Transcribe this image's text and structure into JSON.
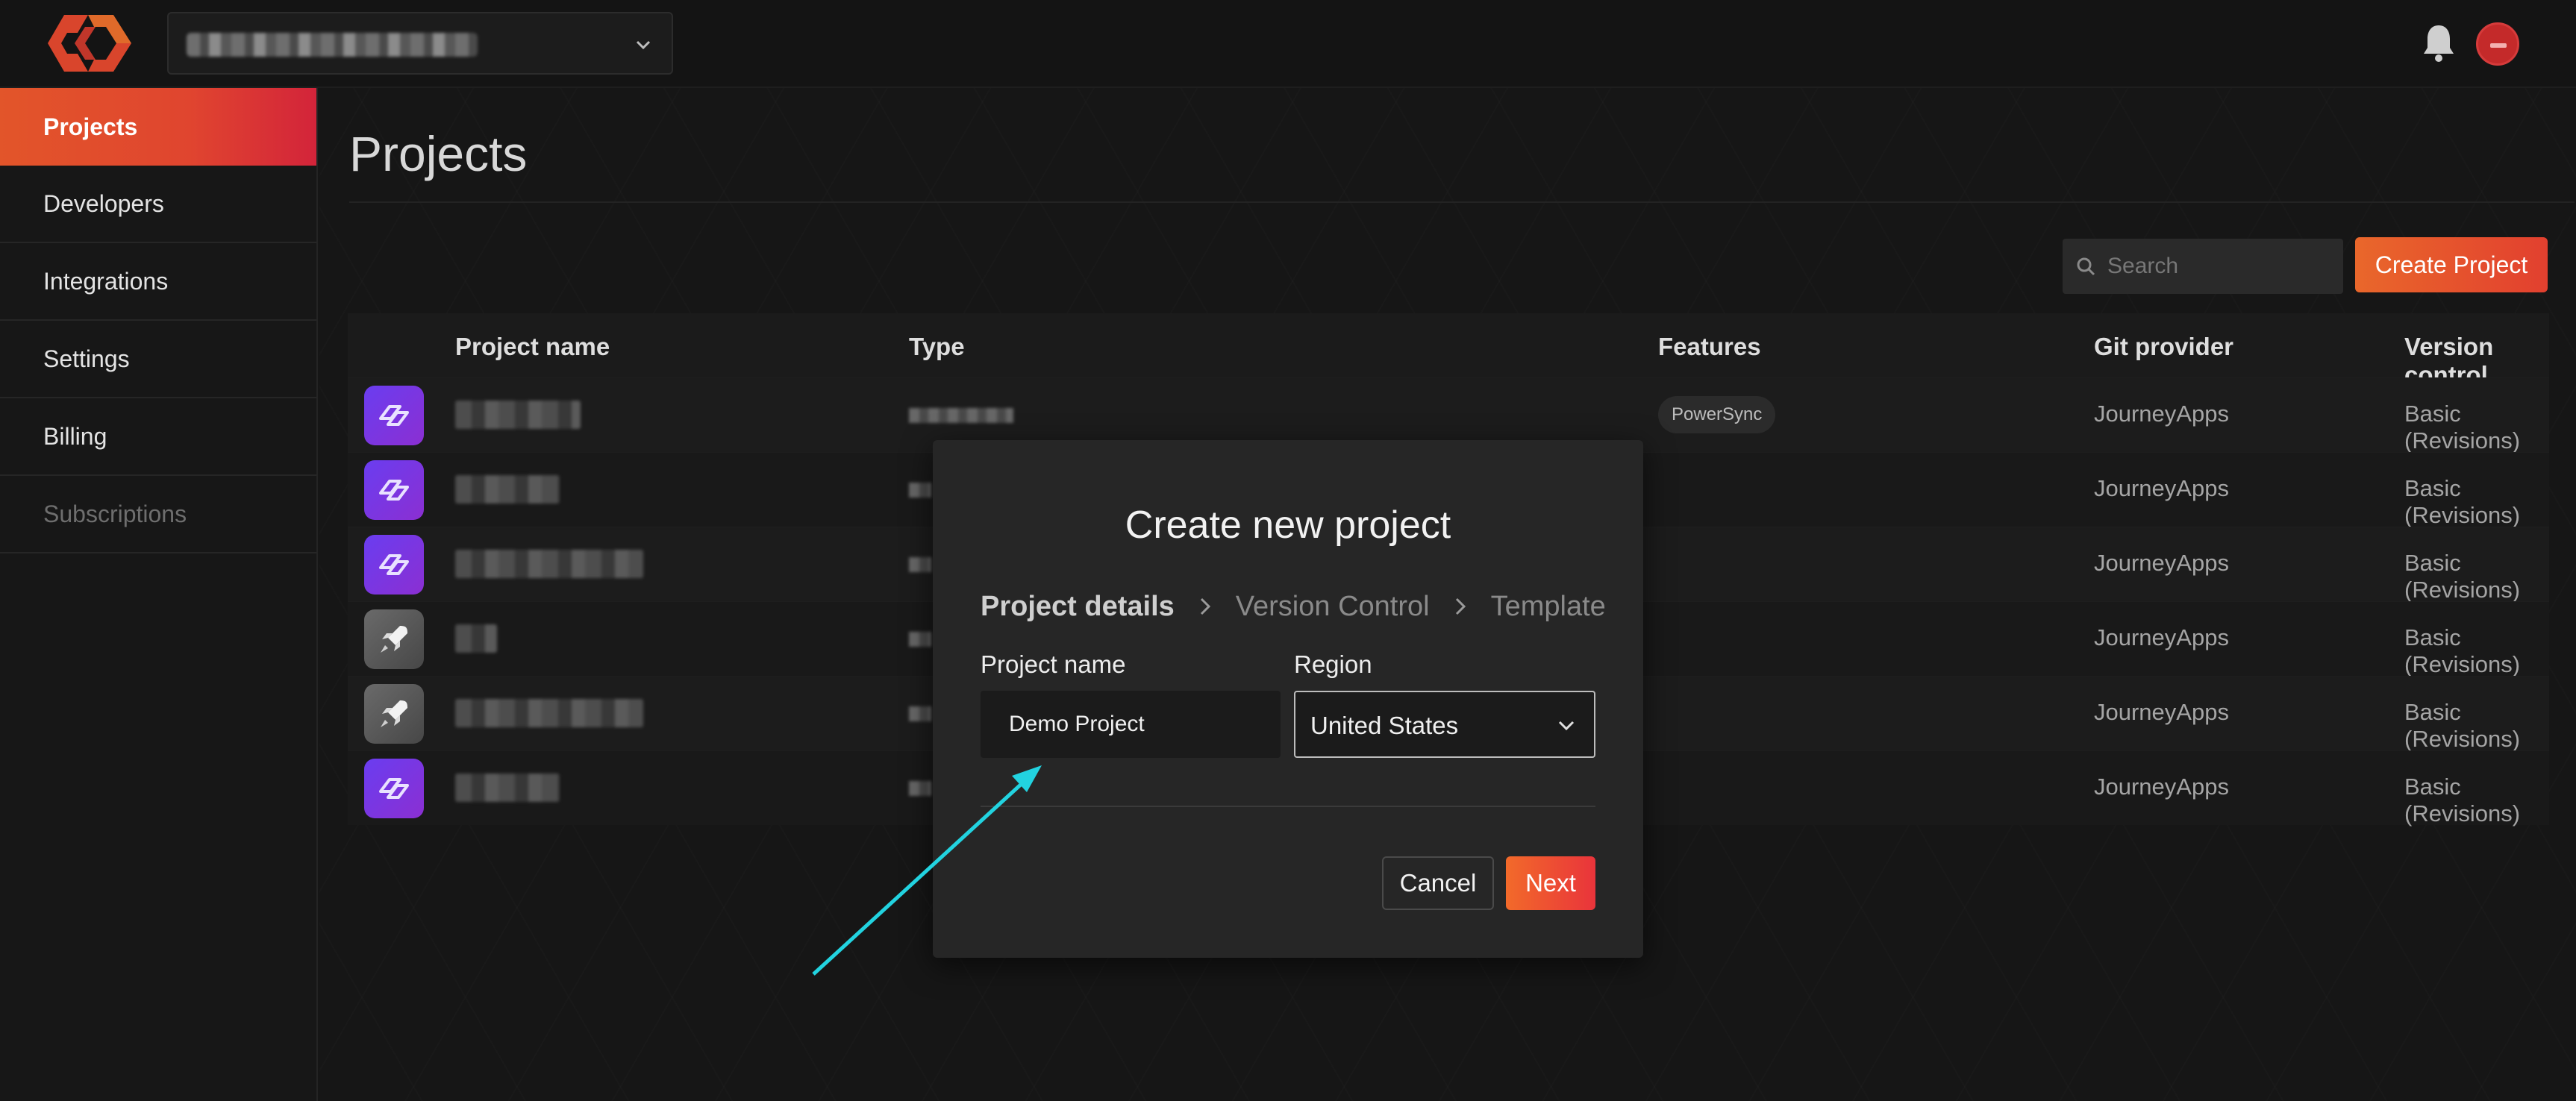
{
  "nav": {
    "items": [
      {
        "label": "Projects"
      },
      {
        "label": "Developers"
      },
      {
        "label": "Integrations"
      },
      {
        "label": "Settings"
      },
      {
        "label": "Billing"
      },
      {
        "label": "Subscriptions"
      }
    ]
  },
  "page": {
    "title": "Projects",
    "search_placeholder": "Search",
    "create_button": "Create Project"
  },
  "table": {
    "headers": {
      "project_name": "Project name",
      "type": "Type",
      "features": "Features",
      "git_provider": "Git provider",
      "version_control": "Version control"
    },
    "rows": [
      {
        "icon": "powersync-icon",
        "feature": "PowerSync",
        "git": "JourneyApps",
        "vc": "Basic (Revisions)"
      },
      {
        "icon": "powersync-icon",
        "feature": "",
        "git": "JourneyApps",
        "vc": "Basic (Revisions)"
      },
      {
        "icon": "powersync-icon",
        "feature": "",
        "git": "JourneyApps",
        "vc": "Basic (Revisions)"
      },
      {
        "icon": "rocket-icon",
        "feature": "",
        "git": "JourneyApps",
        "vc": "Basic (Revisions)"
      },
      {
        "icon": "rocket-icon",
        "feature": "",
        "git": "JourneyApps",
        "vc": "Basic (Revisions)"
      },
      {
        "icon": "powersync-icon",
        "feature": "",
        "git": "JourneyApps",
        "vc": "Basic (Revisions)"
      }
    ]
  },
  "modal": {
    "title": "Create new project",
    "steps": [
      "Project details",
      "Version Control",
      "Template"
    ],
    "project_name_label": "Project name",
    "project_name_value": "Demo Project",
    "region_label": "Region",
    "region_value": "United States",
    "cancel": "Cancel",
    "next": "Next"
  },
  "colors": {
    "accent": "#e2552a",
    "annotation_arrow": "#22d3e0"
  }
}
